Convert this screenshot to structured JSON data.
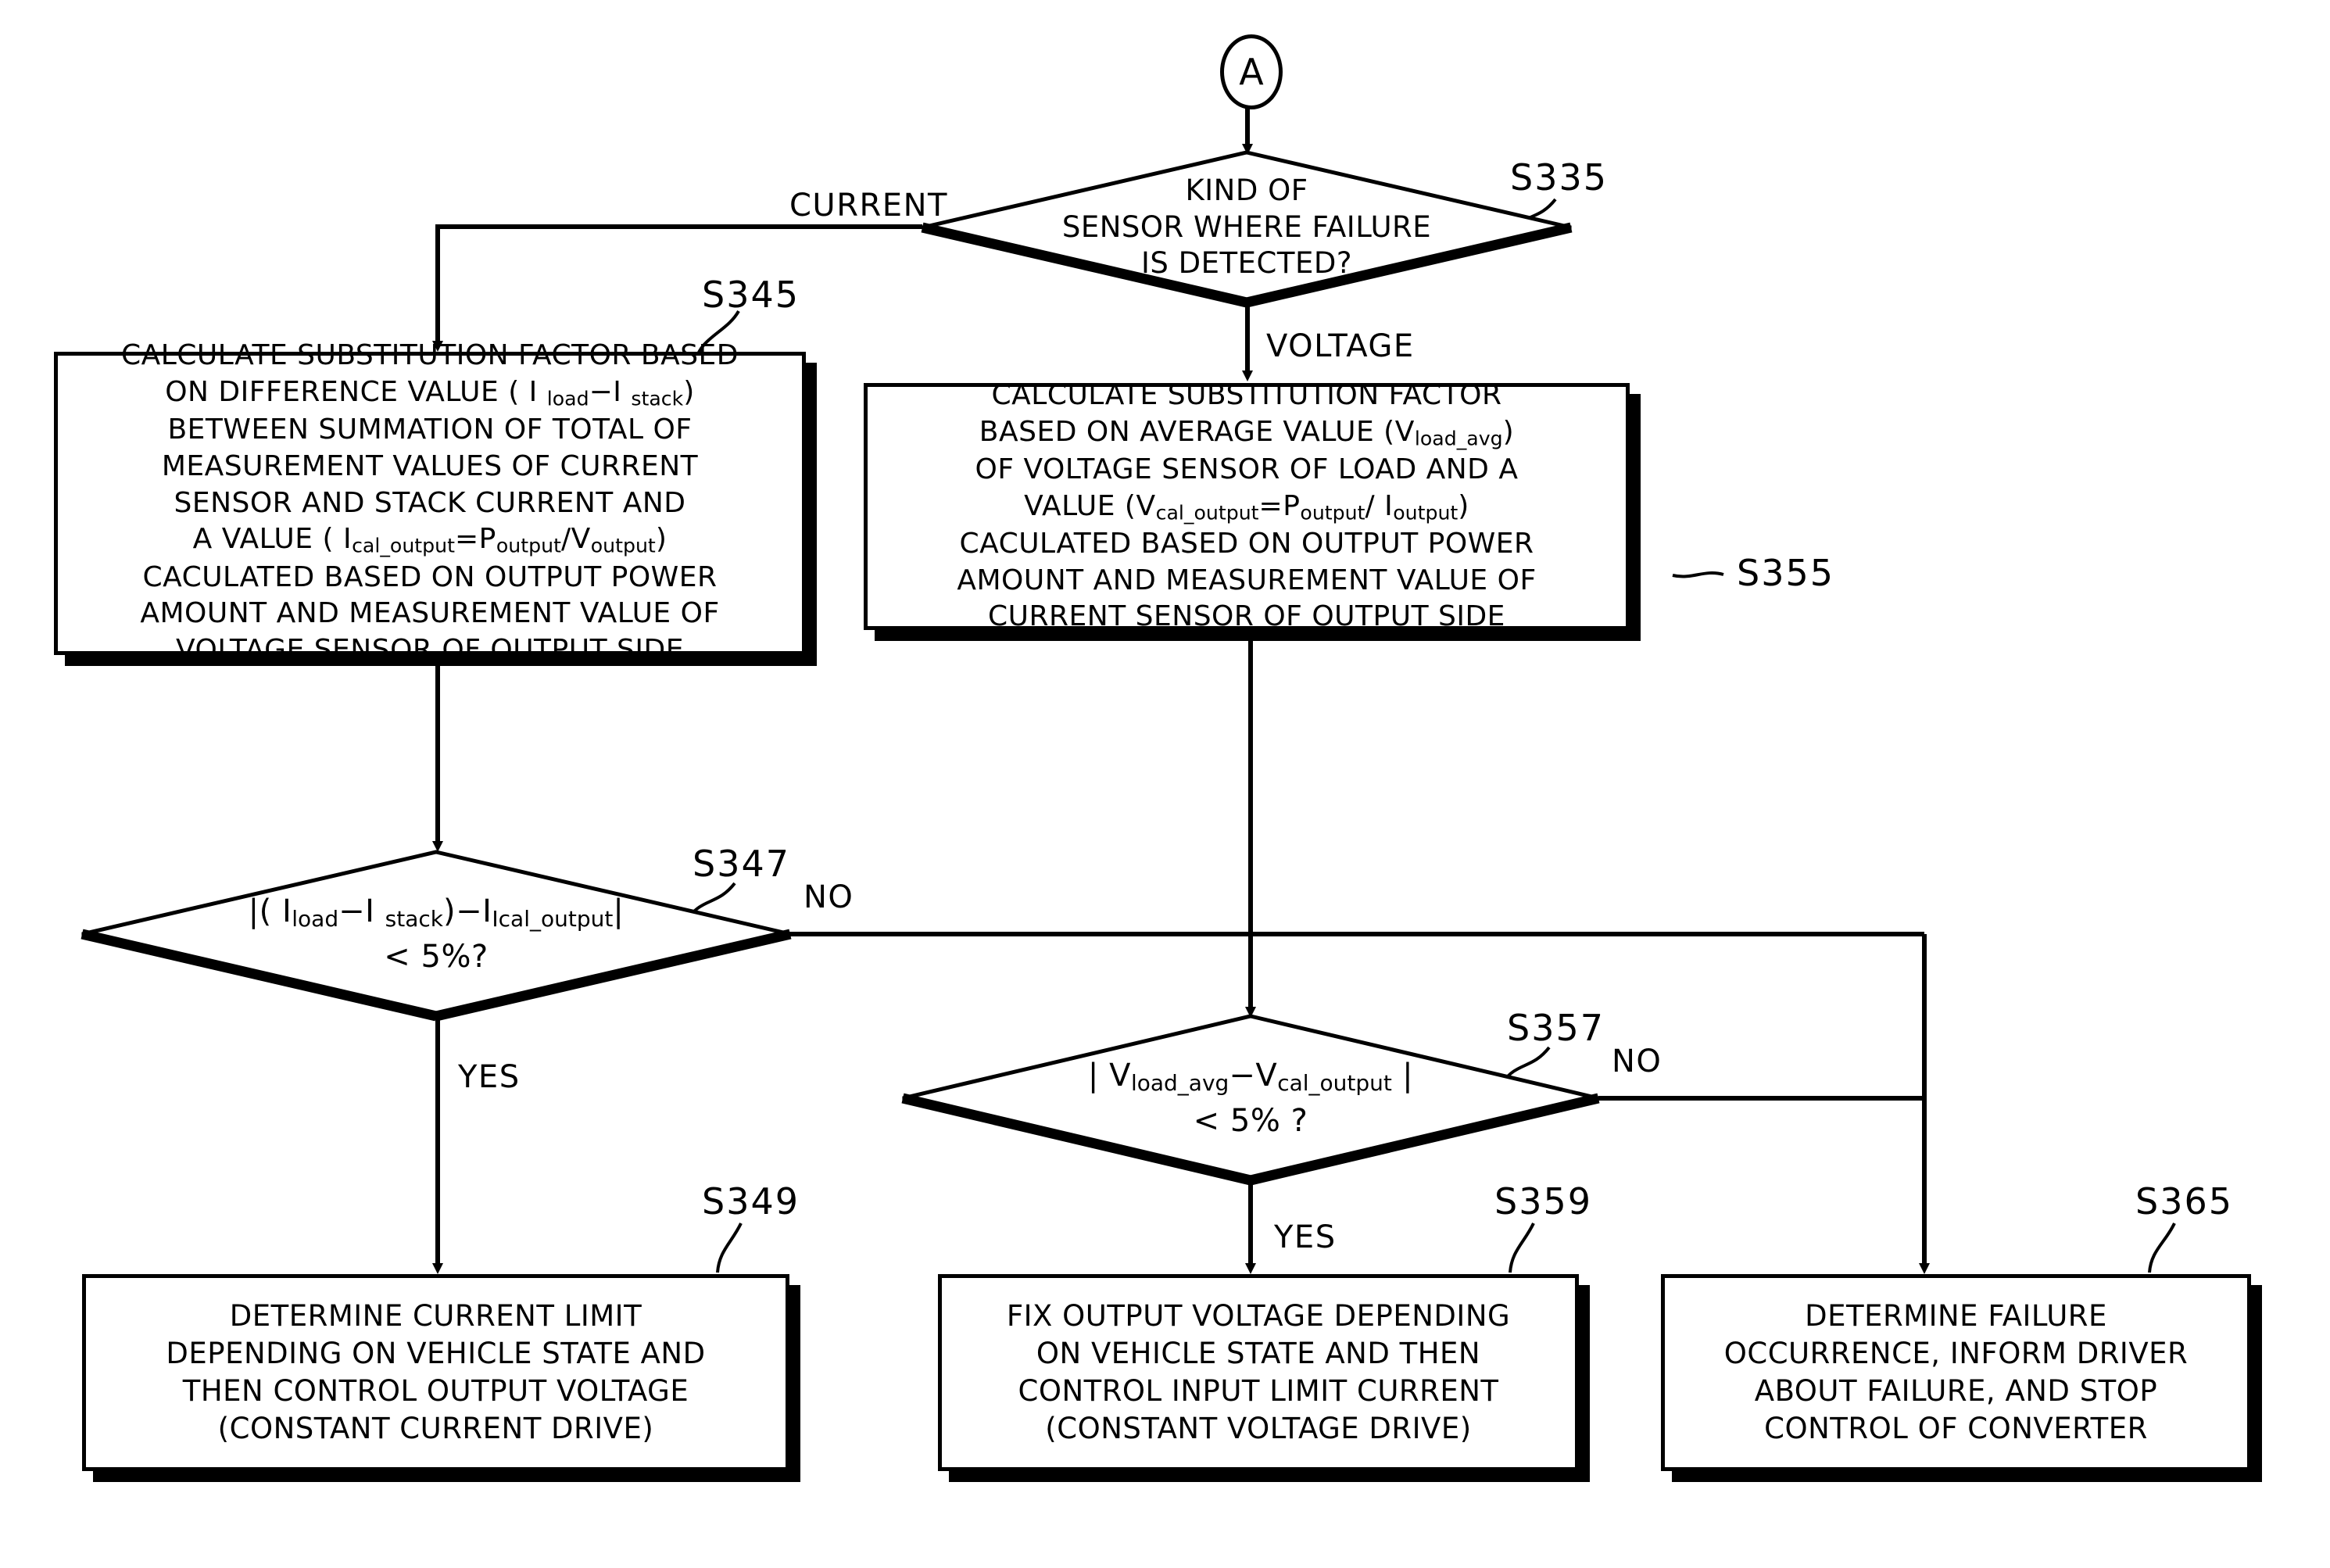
{
  "diagram": {
    "type": "flowchart",
    "title": "",
    "connector": {
      "label": "A",
      "name": "connector-a"
    },
    "nodes": [
      {
        "id": "S335",
        "ref": "S335",
        "shape": "decision",
        "lines": [
          "KIND OF",
          "SENSOR WHERE FAILURE",
          "IS DETECTED?"
        ]
      },
      {
        "id": "S345",
        "ref": "S345",
        "shape": "process",
        "lines_html": [
          "CALCULATE SUBSTITUTION FACTOR BASED",
          "ON DIFFERENCE VALUE ( I <span class='sub'>load</span>−I <span class='sub'>stack</span>)",
          "BETWEEN SUMMATION OF TOTAL OF",
          "MEASUREMENT VALUES OF CURRENT",
          "SENSOR AND STACK CURRENT AND",
          "A VALUE ( I<span class='sub'>cal_output</span>=P<span class='sub'>output</span>/V<span class='sub'>output</span>)",
          "CACULATED BASED ON OUTPUT POWER",
          "AMOUNT AND MEASUREMENT VALUE OF",
          "VOLTAGE SENSOR OF OUTPUT SIDE"
        ],
        "plain": "CALCULATE SUBSTITUTION FACTOR BASED ON DIFFERENCE VALUE (Iload-Istack) BETWEEN SUMMATION OF TOTAL OF MEASUREMENT VALUES OF CURRENT SENSOR AND STACK CURRENT AND A VALUE (Ical_output=Poutput/Voutput) CACULATED BASED ON OUTPUT POWER AMOUNT AND MEASUREMENT VALUE OF VOLTAGE SENSOR OF OUTPUT SIDE"
      },
      {
        "id": "S355",
        "ref": "S355",
        "shape": "process",
        "lines_html": [
          "CALCULATE SUBSTITUTION FACTOR",
          "BASED ON AVERAGE VALUE (V<span class='sub'>load_avg</span>)",
          "OF VOLTAGE SENSOR OF LOAD AND A",
          "VALUE (V<span class='sub'>cal_output</span>=P<span class='sub'>output</span>/ I<span class='sub'>output</span>)",
          "CACULATED BASED ON OUTPUT POWER",
          "AMOUNT AND MEASUREMENT VALUE OF",
          "CURRENT SENSOR OF OUTPUT SIDE"
        ],
        "plain": "CALCULATE SUBSTITUTION FACTOR BASED ON AVERAGE VALUE (Vload_avg) OF VOLTAGE SENSOR OF LOAD AND A VALUE (Vcal_output=Poutput/Ioutput) CACULATED BASED ON OUTPUT POWER AMOUNT AND MEASUREMENT VALUE OF CURRENT SENSOR OF OUTPUT SIDE"
      },
      {
        "id": "S347",
        "ref": "S347",
        "shape": "decision",
        "lines_html": [
          "|( I<span class='sub'>load</span>−I <span class='sub'>stack</span>)−I<span class='sub'>Ical_output</span>|",
          "&lt; 5%?"
        ],
        "plain": "|(Iload-Istack)-IIcal_output| < 5%?"
      },
      {
        "id": "S357",
        "ref": "S357",
        "shape": "decision",
        "lines_html": [
          "| V<span class='sub'>load_avg</span>−V<span class='sub'>cal_output</span> |",
          "&lt; 5% ?"
        ],
        "plain": "|Vload_avg-Vcal_output| < 5% ?"
      },
      {
        "id": "S349",
        "ref": "S349",
        "shape": "process",
        "lines_html": [
          "DETERMINE CURRENT LIMIT",
          "DEPENDING ON VEHICLE STATE AND",
          "THEN CONTROL OUTPUT VOLTAGE",
          "(CONSTANT CURRENT DRIVE)"
        ],
        "plain": "DETERMINE CURRENT LIMIT DEPENDING ON VEHICLE STATE AND THEN CONTROL OUTPUT VOLTAGE (CONSTANT CURRENT DRIVE)"
      },
      {
        "id": "S359",
        "ref": "S359",
        "shape": "process",
        "lines_html": [
          "FIX OUTPUT VOLTAGE DEPENDING",
          "ON VEHICLE STATE AND THEN",
          "CONTROL INPUT LIMIT CURRENT",
          "(CONSTANT VOLTAGE DRIVE)"
        ],
        "plain": "FIX OUTPUT VOLTAGE DEPENDING ON VEHICLE STATE AND THEN CONTROL INPUT LIMIT CURRENT (CONSTANT VOLTAGE DRIVE)"
      },
      {
        "id": "S365",
        "ref": "S365",
        "shape": "process",
        "lines_html": [
          "DETERMINE FAILURE",
          "OCCURRENCE, INFORM DRIVER",
          "ABOUT FAILURE, AND STOP",
          "CONTROL OF CONVERTER"
        ],
        "plain": "DETERMINE FAILURE OCCURRENCE, INFORM DRIVER ABOUT FAILURE, AND STOP CONTROL OF CONVERTER"
      }
    ],
    "edge_labels": {
      "current": "CURRENT",
      "voltage": "VOLTAGE",
      "no_s347": "NO",
      "yes_s347": "YES",
      "no_s357": "NO",
      "yes_s357": "YES"
    },
    "refs": {
      "s335": "S335",
      "s345": "S345",
      "s355": "S355",
      "s347": "S347",
      "s357": "S357",
      "s349": "S349",
      "s359": "S359",
      "s365": "S365"
    },
    "colors": {
      "stroke": "#000000",
      "fill": "#ffffff"
    }
  }
}
